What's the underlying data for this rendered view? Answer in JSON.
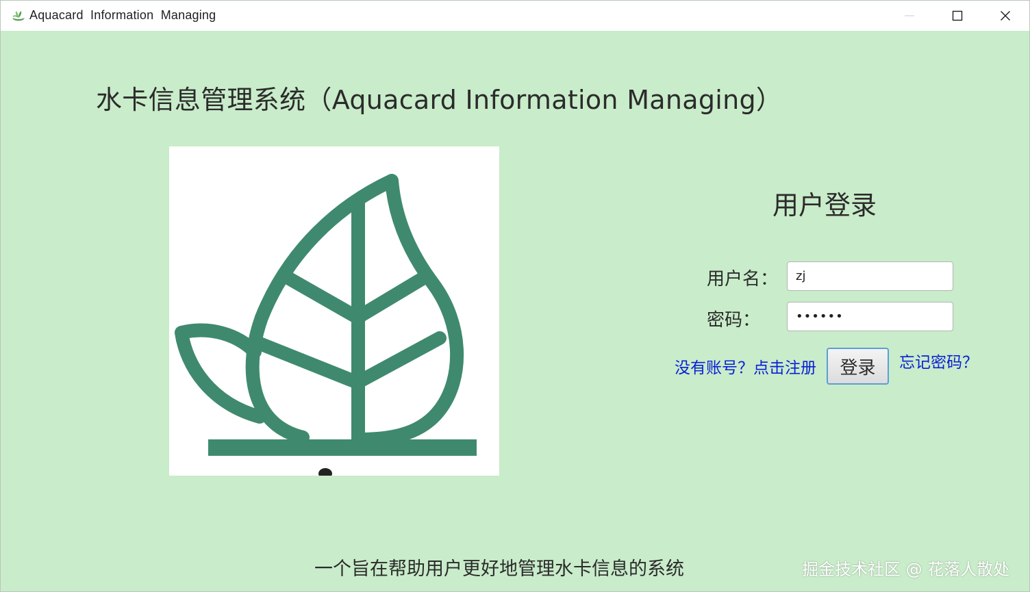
{
  "window": {
    "title": "Aquacard  Information  Managing"
  },
  "main": {
    "heading": "水卡信息管理系统（Aquacard  Information  Managing）",
    "login": {
      "title": "用户登录",
      "username_label": "用户名：",
      "username_value": "zj",
      "password_label": "密码：",
      "password_masked": "••••••",
      "register_link": "没有账号？点击注册",
      "login_button": "登录",
      "forgot_link": "忘记密码？"
    },
    "footer_text": "一个旨在帮助用户更好地管理水卡信息的系统",
    "watermark": "掘金技术社区 @ 花落人散处"
  },
  "colors": {
    "background": "#c9ecca",
    "leaf": "#3f8a6e",
    "link": "#0a1fd6"
  }
}
